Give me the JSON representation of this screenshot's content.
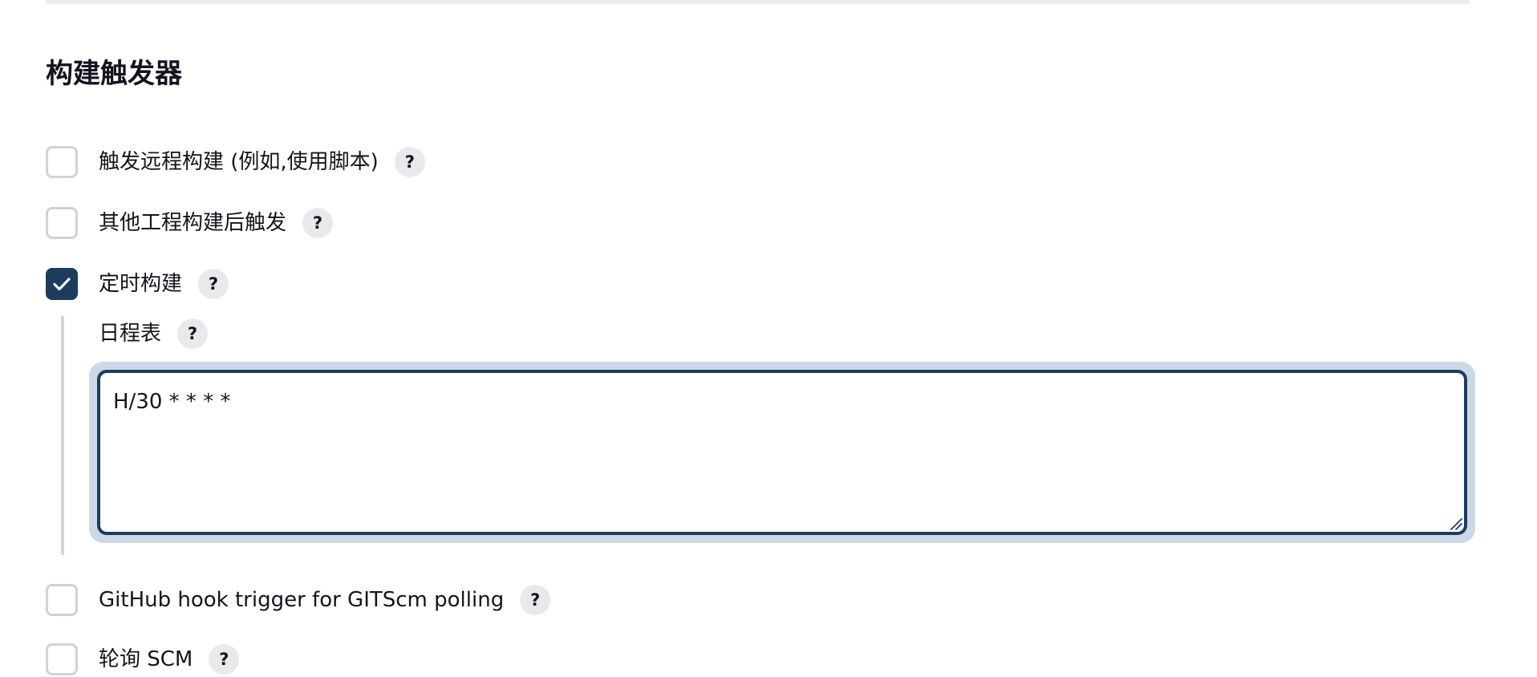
{
  "section": {
    "title": "构建触发器"
  },
  "triggers": [
    {
      "label": "触发远程构建 (例如,使用脚本)",
      "checked": false,
      "help": "?"
    },
    {
      "label": "其他工程构建后触发",
      "checked": false,
      "help": "?"
    },
    {
      "label": "定时构建",
      "checked": true,
      "help": "?"
    },
    {
      "label": "GitHub hook trigger for GITScm polling",
      "checked": false,
      "help": "?"
    },
    {
      "label": "轮询 SCM",
      "checked": false,
      "help": "?"
    }
  ],
  "schedule": {
    "label": "日程表",
    "help": "?",
    "value": "H/30 * * * *"
  },
  "colors": {
    "accent": "#1d3c5e",
    "focus_ring": "#ccd8e5",
    "help_bg": "#e9e9ec",
    "checkbox_border": "#d0d2d6"
  },
  "icons": {
    "checkmark": "check-icon",
    "help": "question-mark-icon",
    "resize": "resize-grip-icon"
  }
}
